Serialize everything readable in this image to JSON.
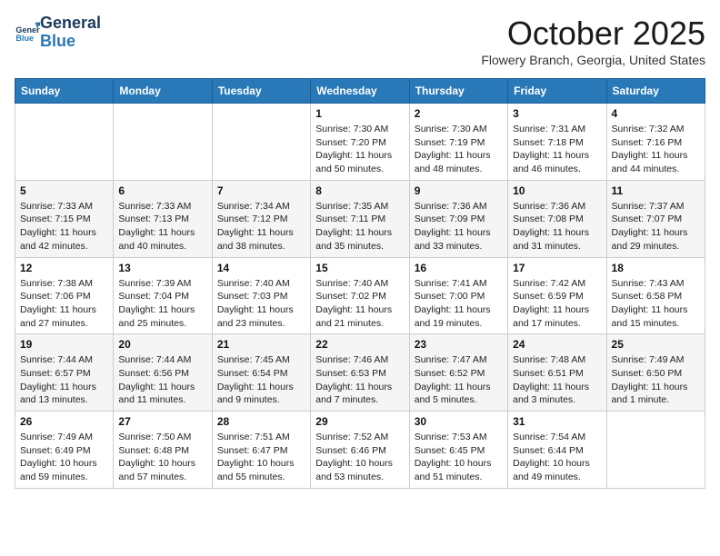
{
  "logo": {
    "line1": "General",
    "line2": "Blue"
  },
  "title": "October 2025",
  "subtitle": "Flowery Branch, Georgia, United States",
  "days_of_week": [
    "Sunday",
    "Monday",
    "Tuesday",
    "Wednesday",
    "Thursday",
    "Friday",
    "Saturday"
  ],
  "weeks": [
    [
      {
        "day": "",
        "info": ""
      },
      {
        "day": "",
        "info": ""
      },
      {
        "day": "",
        "info": ""
      },
      {
        "day": "1",
        "info": "Sunrise: 7:30 AM\nSunset: 7:20 PM\nDaylight: 11 hours and 50 minutes."
      },
      {
        "day": "2",
        "info": "Sunrise: 7:30 AM\nSunset: 7:19 PM\nDaylight: 11 hours and 48 minutes."
      },
      {
        "day": "3",
        "info": "Sunrise: 7:31 AM\nSunset: 7:18 PM\nDaylight: 11 hours and 46 minutes."
      },
      {
        "day": "4",
        "info": "Sunrise: 7:32 AM\nSunset: 7:16 PM\nDaylight: 11 hours and 44 minutes."
      }
    ],
    [
      {
        "day": "5",
        "info": "Sunrise: 7:33 AM\nSunset: 7:15 PM\nDaylight: 11 hours and 42 minutes."
      },
      {
        "day": "6",
        "info": "Sunrise: 7:33 AM\nSunset: 7:13 PM\nDaylight: 11 hours and 40 minutes."
      },
      {
        "day": "7",
        "info": "Sunrise: 7:34 AM\nSunset: 7:12 PM\nDaylight: 11 hours and 38 minutes."
      },
      {
        "day": "8",
        "info": "Sunrise: 7:35 AM\nSunset: 7:11 PM\nDaylight: 11 hours and 35 minutes."
      },
      {
        "day": "9",
        "info": "Sunrise: 7:36 AM\nSunset: 7:09 PM\nDaylight: 11 hours and 33 minutes."
      },
      {
        "day": "10",
        "info": "Sunrise: 7:36 AM\nSunset: 7:08 PM\nDaylight: 11 hours and 31 minutes."
      },
      {
        "day": "11",
        "info": "Sunrise: 7:37 AM\nSunset: 7:07 PM\nDaylight: 11 hours and 29 minutes."
      }
    ],
    [
      {
        "day": "12",
        "info": "Sunrise: 7:38 AM\nSunset: 7:06 PM\nDaylight: 11 hours and 27 minutes."
      },
      {
        "day": "13",
        "info": "Sunrise: 7:39 AM\nSunset: 7:04 PM\nDaylight: 11 hours and 25 minutes."
      },
      {
        "day": "14",
        "info": "Sunrise: 7:40 AM\nSunset: 7:03 PM\nDaylight: 11 hours and 23 minutes."
      },
      {
        "day": "15",
        "info": "Sunrise: 7:40 AM\nSunset: 7:02 PM\nDaylight: 11 hours and 21 minutes."
      },
      {
        "day": "16",
        "info": "Sunrise: 7:41 AM\nSunset: 7:00 PM\nDaylight: 11 hours and 19 minutes."
      },
      {
        "day": "17",
        "info": "Sunrise: 7:42 AM\nSunset: 6:59 PM\nDaylight: 11 hours and 17 minutes."
      },
      {
        "day": "18",
        "info": "Sunrise: 7:43 AM\nSunset: 6:58 PM\nDaylight: 11 hours and 15 minutes."
      }
    ],
    [
      {
        "day": "19",
        "info": "Sunrise: 7:44 AM\nSunset: 6:57 PM\nDaylight: 11 hours and 13 minutes."
      },
      {
        "day": "20",
        "info": "Sunrise: 7:44 AM\nSunset: 6:56 PM\nDaylight: 11 hours and 11 minutes."
      },
      {
        "day": "21",
        "info": "Sunrise: 7:45 AM\nSunset: 6:54 PM\nDaylight: 11 hours and 9 minutes."
      },
      {
        "day": "22",
        "info": "Sunrise: 7:46 AM\nSunset: 6:53 PM\nDaylight: 11 hours and 7 minutes."
      },
      {
        "day": "23",
        "info": "Sunrise: 7:47 AM\nSunset: 6:52 PM\nDaylight: 11 hours and 5 minutes."
      },
      {
        "day": "24",
        "info": "Sunrise: 7:48 AM\nSunset: 6:51 PM\nDaylight: 11 hours and 3 minutes."
      },
      {
        "day": "25",
        "info": "Sunrise: 7:49 AM\nSunset: 6:50 PM\nDaylight: 11 hours and 1 minute."
      }
    ],
    [
      {
        "day": "26",
        "info": "Sunrise: 7:49 AM\nSunset: 6:49 PM\nDaylight: 10 hours and 59 minutes."
      },
      {
        "day": "27",
        "info": "Sunrise: 7:50 AM\nSunset: 6:48 PM\nDaylight: 10 hours and 57 minutes."
      },
      {
        "day": "28",
        "info": "Sunrise: 7:51 AM\nSunset: 6:47 PM\nDaylight: 10 hours and 55 minutes."
      },
      {
        "day": "29",
        "info": "Sunrise: 7:52 AM\nSunset: 6:46 PM\nDaylight: 10 hours and 53 minutes."
      },
      {
        "day": "30",
        "info": "Sunrise: 7:53 AM\nSunset: 6:45 PM\nDaylight: 10 hours and 51 minutes."
      },
      {
        "day": "31",
        "info": "Sunrise: 7:54 AM\nSunset: 6:44 PM\nDaylight: 10 hours and 49 minutes."
      },
      {
        "day": "",
        "info": ""
      }
    ]
  ]
}
